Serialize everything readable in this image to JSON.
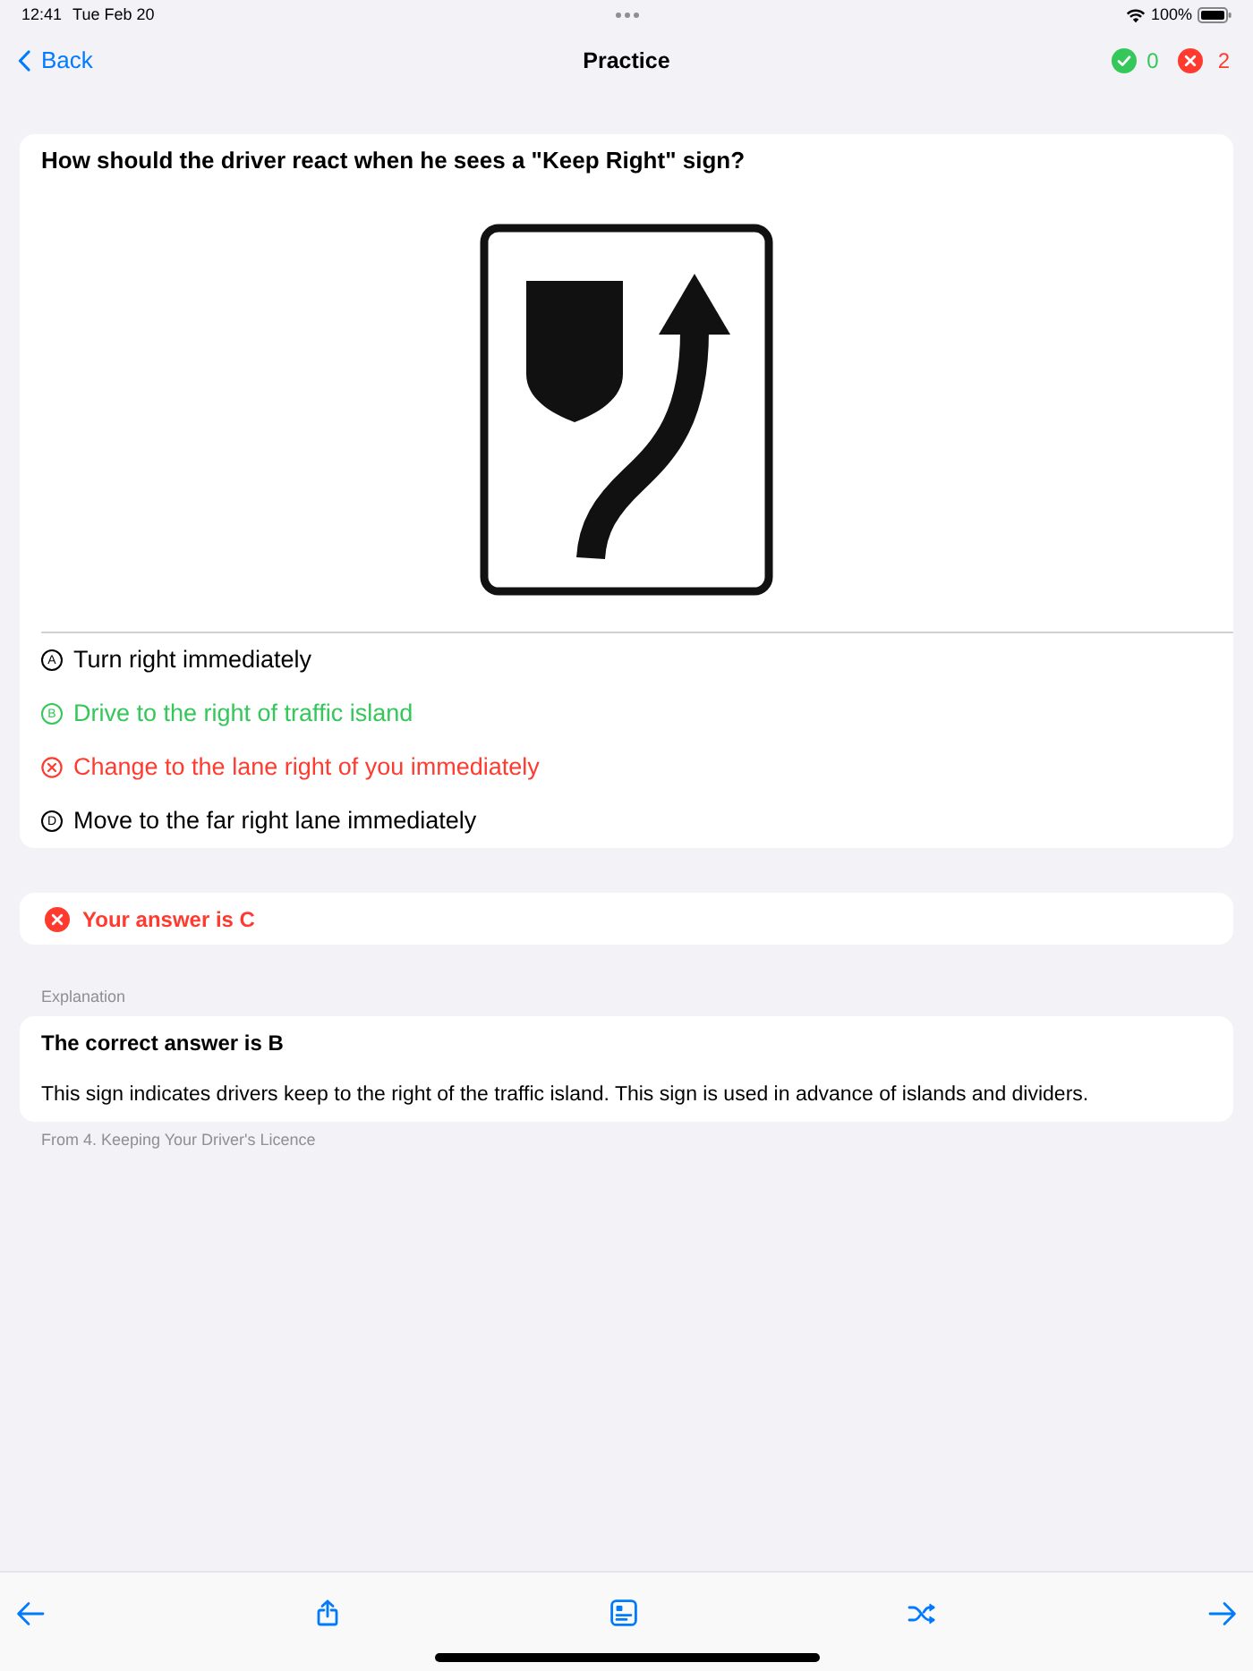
{
  "status_bar": {
    "time": "12:41",
    "date": "Tue Feb 20",
    "battery": "100%"
  },
  "nav_bar": {
    "back_label": "Back",
    "title": "Practice",
    "correct_count": "0",
    "wrong_count": "2"
  },
  "question": {
    "text": "How should the driver react when he sees a \"Keep Right\" sign?",
    "options": [
      {
        "letter": "A",
        "text": "Turn right immediately",
        "selected": false,
        "correct": false
      },
      {
        "letter": "B",
        "text": "Drive to the right of traffic island",
        "selected": false,
        "correct": true
      },
      {
        "text": "Change to the lane right of you immediately",
        "selected": true,
        "correct": false
      },
      {
        "letter": "D",
        "text": "Move to the far right lane immediately",
        "selected": false,
        "correct": false
      }
    ]
  },
  "result": {
    "correct": false,
    "text": "Your answer is C"
  },
  "explanation": {
    "label": "Explanation",
    "heading": "The correct answer is B",
    "body": "This sign indicates drivers keep to the right of the traffic island. This sign is used in advance of islands and dividers.",
    "source": "From 4. Keeping Your Driver's Licence"
  }
}
